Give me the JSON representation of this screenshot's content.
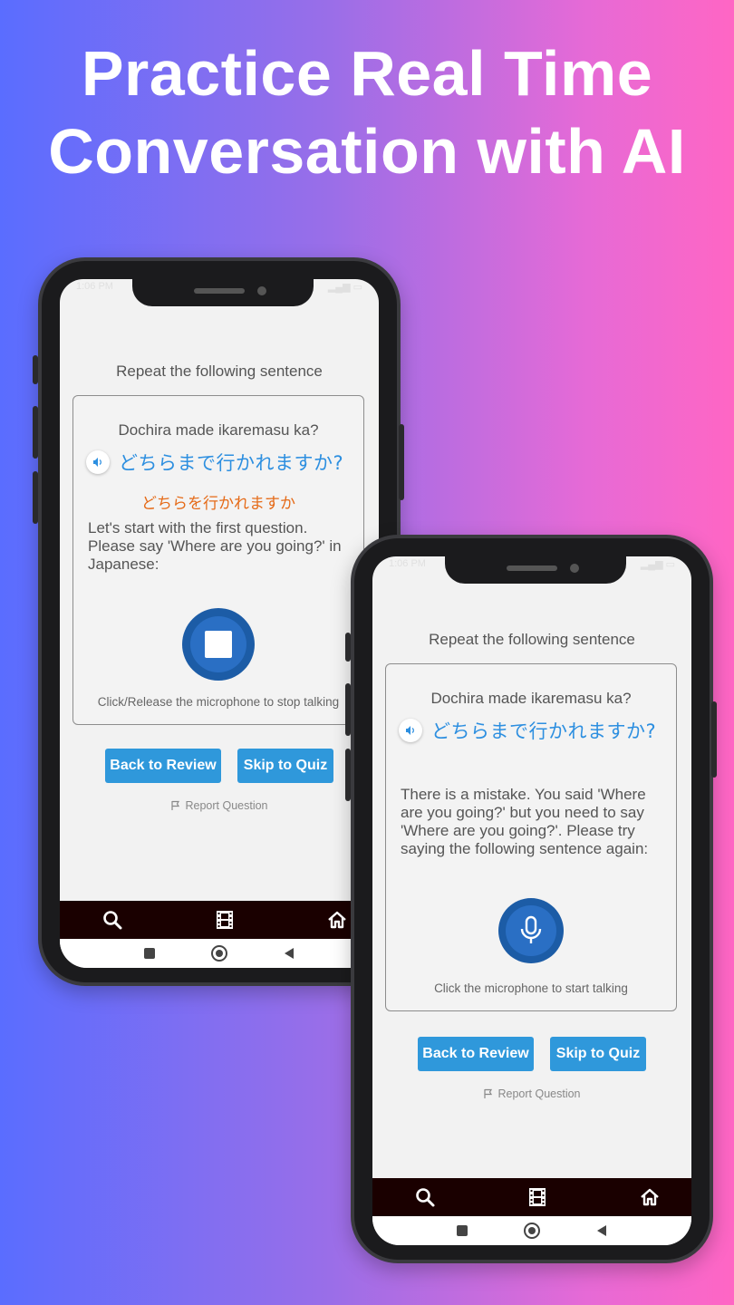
{
  "headline": {
    "line1": "Practice Real Time",
    "line2": "Conversation with AI"
  },
  "phone1": {
    "status_time": "1:06 PM",
    "prompt": "Repeat the following sentence",
    "romaji": "Dochira made ikaremasu ka?",
    "japanese": "どちらまで行かれますか?",
    "heard": "どちらを行かれますか",
    "message": "Let's start with the first question. Please say 'Where are you going?' in Japanese:",
    "mic_state": "stop",
    "hint": "Click/Release the microphone to stop talking",
    "back_label": "Back to Review",
    "skip_label": "Skip to Quiz",
    "report_label": "Report Question"
  },
  "phone2": {
    "status_time": "1:06 PM",
    "prompt": "Repeat the following sentence",
    "romaji": "Dochira made ikaremasu ka?",
    "japanese": "どちらまで行かれますか?",
    "message": "There is a mistake. You said 'Where are you going?' but you need to say 'Where are you going?'. Please try saying the following sentence again:",
    "mic_state": "record",
    "hint": "Click the microphone to start talking",
    "back_label": "Back to Review",
    "skip_label": "Skip to Quiz",
    "report_label": "Report Question"
  },
  "colors": {
    "accent_blue": "#2f98db",
    "japanese_text": "#2d8fe0",
    "heard_text": "#e56a17",
    "mic_blue": "#1c5ca6",
    "nav_bar": "#1a0000"
  }
}
